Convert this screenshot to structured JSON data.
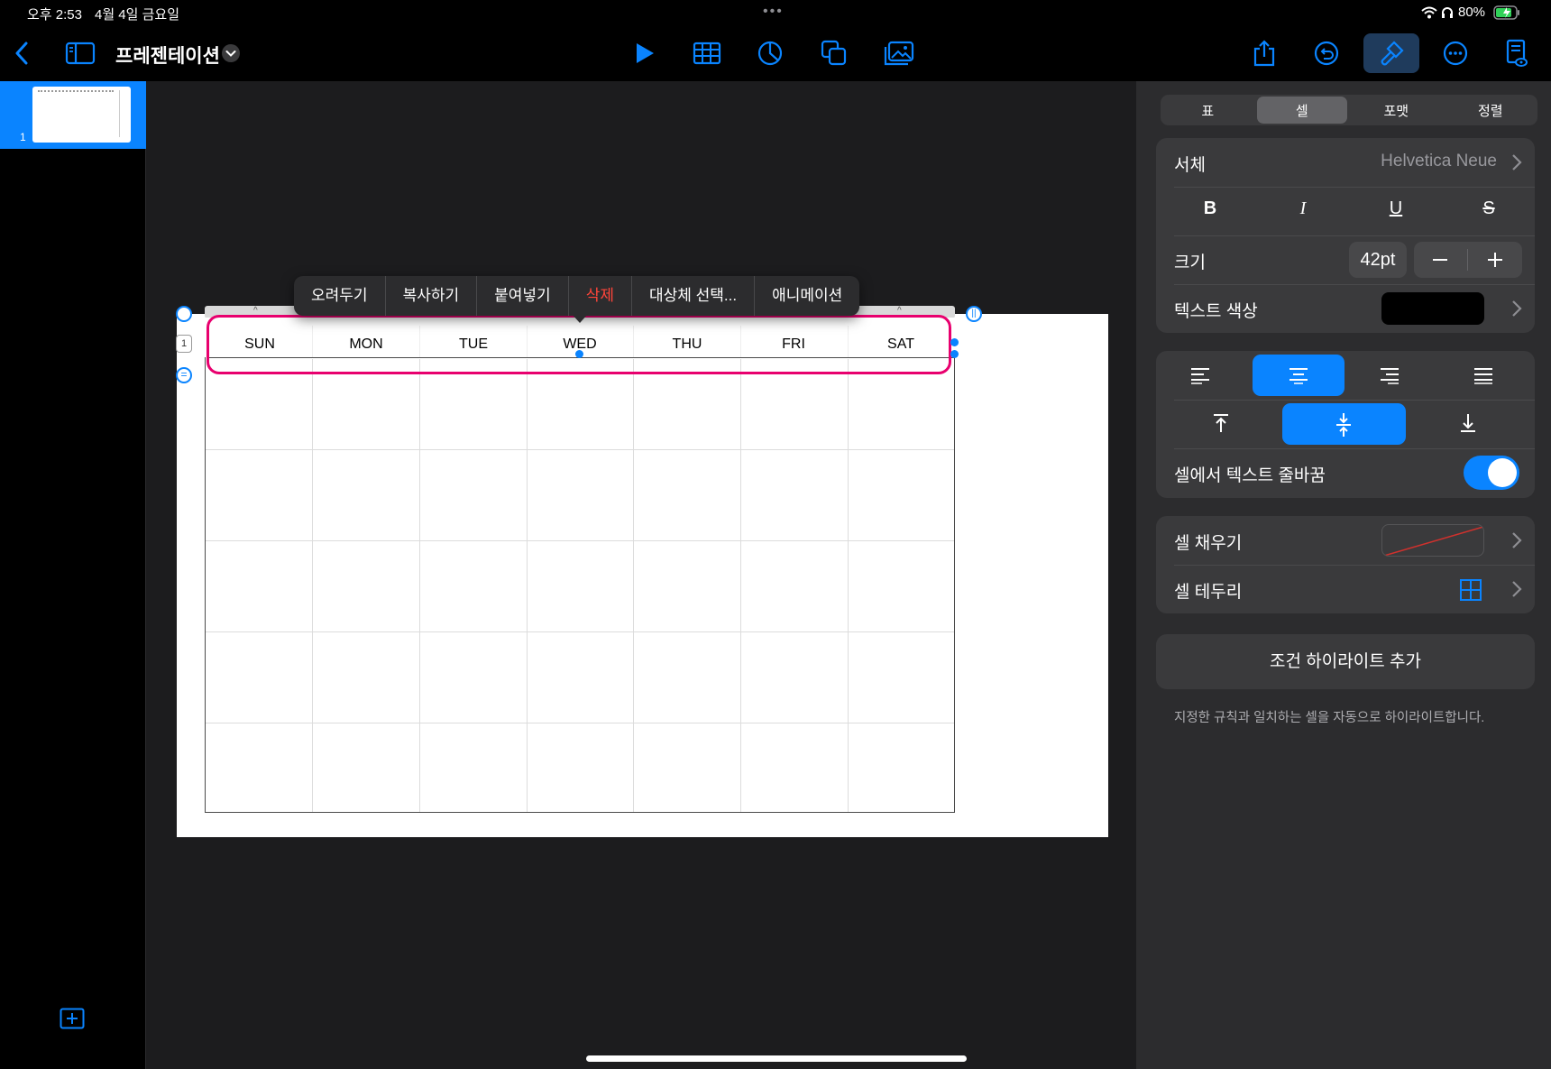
{
  "status_bar": {
    "time": "오후 2:53",
    "date": "4월 4일 금요일",
    "battery": "80%"
  },
  "toolbar": {
    "title": "프레젠테이션"
  },
  "navigator": {
    "slide_number": "1"
  },
  "table": {
    "row_number": "1",
    "days": [
      "SUN",
      "MON",
      "TUE",
      "WED",
      "THU",
      "FRI",
      "SAT"
    ]
  },
  "context_menu": {
    "items": [
      "오려두기",
      "복사하기",
      "붙여넣기",
      "삭제",
      "대상체 선택...",
      "애니메이션"
    ]
  },
  "inspector": {
    "tabs": [
      "표",
      "셀",
      "포맷",
      "정렬"
    ],
    "active_tab": "셀",
    "font_label": "서체",
    "font_value": "Helvetica Neue",
    "style_buttons": [
      "B",
      "I",
      "U",
      "S"
    ],
    "size_label": "크기",
    "size_value": "42pt",
    "text_color_label": "텍스트 색상",
    "wrap_label": "셀에서 텍스트 줄바꿈",
    "wrap_on": true,
    "fill_label": "셀 채우기",
    "border_label": "셀 테두리",
    "conditional_button": "조건 하이라이트 추가",
    "conditional_desc": "지정한 규칙과 일치하는 셀을 자동으로 하이라이트합니다."
  },
  "colors": {
    "accent": "#0a84ff",
    "highlight": "#e8006e",
    "danger": "#ff453a"
  }
}
